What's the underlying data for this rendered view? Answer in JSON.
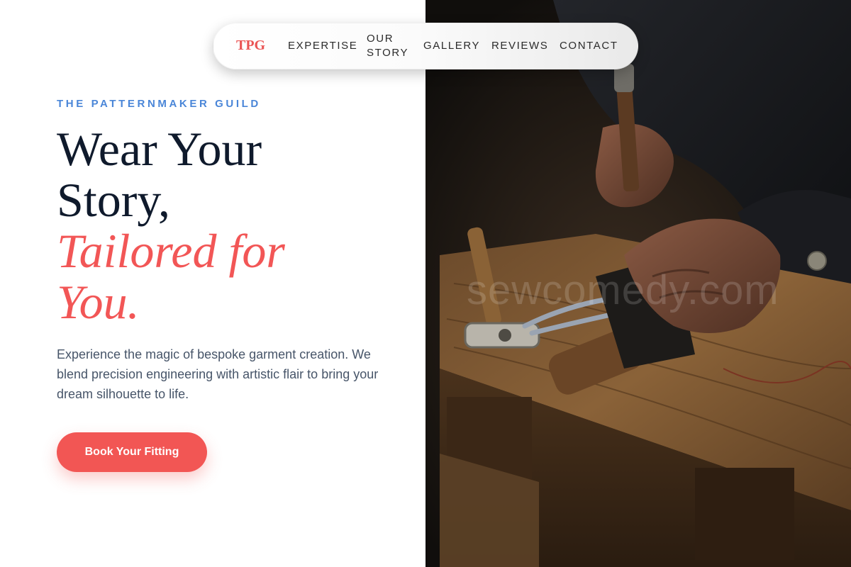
{
  "nav": {
    "brand": "TPG",
    "links": [
      "EXPERTISE",
      "OUR STORY",
      "GALLERY",
      "REVIEWS",
      "CONTACT"
    ]
  },
  "hero": {
    "eyebrow": "THE PATTERNMAKER GUILD",
    "headline_line1": "Wear Your",
    "headline_line2": "Story,",
    "headline_accent1": "Tailored for",
    "headline_accent2": "You.",
    "lede": "Experience the magic of bespoke garment creation. We blend precision engineering with artistic flair to bring your dream silhouette to life.",
    "cta_label": "Book Your Fitting"
  },
  "photo": {
    "watermark": "sewcomedy.com"
  },
  "colors": {
    "accent": "#f25654",
    "eyebrow": "#4a86d8",
    "headline": "#0f1a2c",
    "body": "#475569"
  }
}
